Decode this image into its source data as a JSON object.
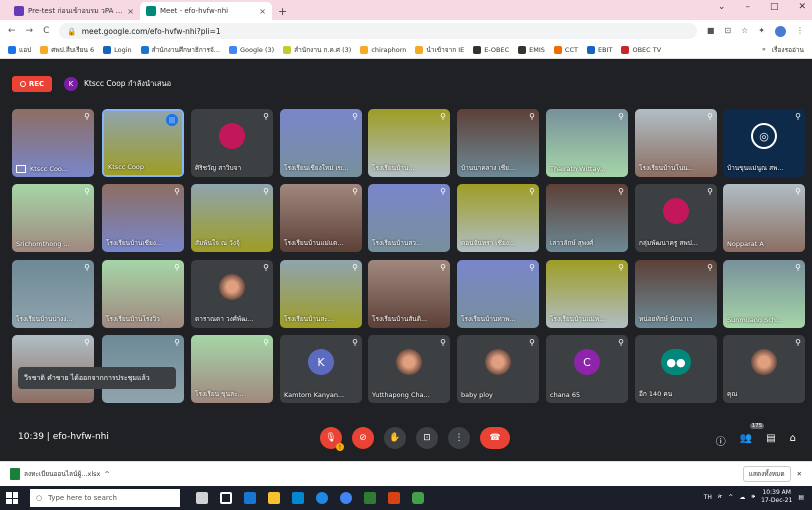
{
  "browser": {
    "tabs": [
      {
        "title": "Pre-test ก่อนเข้าอบรม วPA - Go",
        "close": "×",
        "active": false
      },
      {
        "title": "Meet - efo-hvfw-nhi",
        "close": "×",
        "active": true
      }
    ],
    "new_tab": "+",
    "window_controls": [
      "⌄",
      "–",
      "□",
      "✕"
    ],
    "url": "meet.google.com/efo-hvfw-nhi?pli=1",
    "bookmarks": [
      "แอป",
      "ศพป.สืบเรียน 6",
      "Login",
      "สำนักงานศึกษาธิการจั...",
      "Google (3)",
      "สำนักงาน ก.ค.ศ (3)",
      "chiraphorn",
      "นำเข้าจาก IE",
      "E-OBEC",
      "EMIS",
      "CCT",
      "EBIT",
      "OBEC TV"
    ],
    "bookmark_overflow": "»",
    "reading_list": "เรื่องรออ่าน"
  },
  "meet": {
    "rec_label": "REC",
    "presenter_initial": "K",
    "presenter_text": "Ktscc Coop กำลังนำเสนอ",
    "tiles": [
      {
        "name": "Ktscc Coo...",
        "kind": "screen"
      },
      {
        "name": "Ktscc Coop",
        "kind": "video-speaking"
      },
      {
        "name": "ศิริชวัญ สาวิบจา",
        "kind": "avatar",
        "initial": "",
        "color": "#c2185b"
      },
      {
        "name": "โรงเรียนเชียงใหม่ เข...",
        "kind": "video"
      },
      {
        "name": "โรงเรียนบ้าน...",
        "kind": "video"
      },
      {
        "name": "บ้านนาคลาง เชีย...",
        "kind": "video"
      },
      {
        "name": "Thairath Wittay...",
        "kind": "video"
      },
      {
        "name": "โรงเรียนบ้านโนน...",
        "kind": "video"
      },
      {
        "name": "บ้านขุนแม่นูณ สพ...",
        "kind": "logo"
      },
      {
        "name": "Srichomthong ...",
        "kind": "video"
      },
      {
        "name": "โรงเรียนบ้านเชียง...",
        "kind": "video"
      },
      {
        "name": "สัมพันใจ ณ วังจุ้",
        "kind": "video"
      },
      {
        "name": "โรงเรียนบ้านแม่แต...",
        "kind": "video"
      },
      {
        "name": "โรงเรียนบ้านสว...",
        "kind": "video"
      },
      {
        "name": "ดอนจันทรา เชียง...",
        "kind": "video"
      },
      {
        "name": "เสาวลักษ์ สุพงศ์",
        "kind": "video"
      },
      {
        "name": "กลุ่มพัฒนาครู สพป...",
        "kind": "avatar",
        "initial": "",
        "color": "#c2185b"
      },
      {
        "name": "Nopparat A",
        "kind": "video"
      },
      {
        "name": "โรงเรียนบ้านปางง...",
        "kind": "video"
      },
      {
        "name": "โรงเรียนบ้านโรงวิว",
        "kind": "video"
      },
      {
        "name": "ดาราณดา วงศ์พัฒ...",
        "kind": "avatar-photo"
      },
      {
        "name": "โรงเรียนบ้านสะ...",
        "kind": "video"
      },
      {
        "name": "โรงเรียนบ้านสันติ...",
        "kind": "video"
      },
      {
        "name": "โรงเรียนบ้านท่าพ...",
        "kind": "video"
      },
      {
        "name": "โรงเรียนบ้านแม่ห...",
        "kind": "video"
      },
      {
        "name": "หน่อยทักษ์ นักนาเว",
        "kind": "video"
      },
      {
        "name": "Sunmuang Sch...",
        "kind": "video"
      },
      {
        "name": "",
        "kind": "video"
      },
      {
        "name": "",
        "kind": "video"
      },
      {
        "name": "โรงเรียน ขุนสะ...",
        "kind": "video"
      },
      {
        "name": "Kamtorn Kanyan...",
        "kind": "avatar",
        "initial": "K",
        "color": "#5c6bc0"
      },
      {
        "name": "Yutthapong Cha...",
        "kind": "avatar-photo"
      },
      {
        "name": "baby ploy",
        "kind": "avatar-photo"
      },
      {
        "name": "chana 65",
        "kind": "avatar",
        "initial": "C",
        "color": "#8e24aa"
      },
      {
        "name": "อีก 140 คน",
        "kind": "more"
      },
      {
        "name": "คุณ",
        "kind": "avatar-photo"
      }
    ],
    "toast": "วีรชาติ คำชาย ได้ออกจากการประชุมแล้ว",
    "time_and_code": "10:39 | efo-hvfw-nhi",
    "participant_count": "175"
  },
  "downloads": {
    "file": "ลงทะเบียนออนไลน์ผู้...xlsx",
    "chevron": "^",
    "show_all": "แสดงทั้งหมด"
  },
  "taskbar": {
    "search_placeholder": "Type here to search",
    "lang": "TH",
    "time": "10:39 AM",
    "date": "17-Dec-21"
  }
}
